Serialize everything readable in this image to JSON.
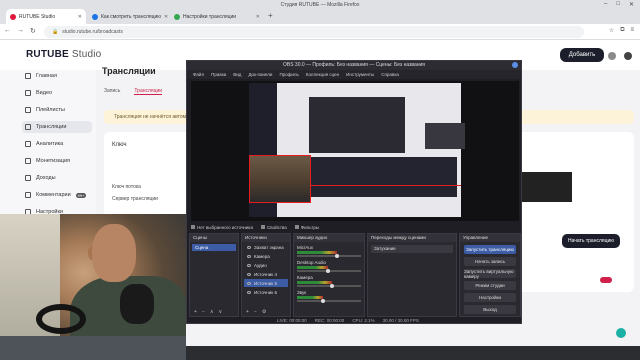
{
  "browser": {
    "window_title": "Студия RUTUBE — Mozilla Firefox",
    "tabs": [
      {
        "label": "RUTUBE Studio",
        "active": true,
        "color": "#e0193c"
      },
      {
        "label": "Как смотреть трансляцию",
        "active": false,
        "color": "#1a73e8"
      },
      {
        "label": "Настройки трансляции",
        "active": false,
        "color": "#34a853"
      }
    ],
    "address": "studio.rutube.ru/broadcasts",
    "nav": {
      "back": "←",
      "forward": "→",
      "reload": "↻"
    },
    "window_controls": {
      "minimize": "–",
      "maximize": "□",
      "close": "✕"
    }
  },
  "studio": {
    "logo_main": "RUTUBE",
    "logo_sub": "Studio",
    "add_button": "Добавить",
    "page_title": "Трансляции",
    "tabs": [
      "Запись",
      "Трансляции"
    ],
    "active_tab": 1,
    "warning": "Трансляция не начнётся автоматически — запустите её вручную",
    "card_label": "Ключ",
    "card_rows": [
      "Ключ потока",
      "Сервер трансляции"
    ],
    "start_button": "Начать трансляцию",
    "accent": "#d0204b"
  },
  "sidebar": {
    "items": [
      {
        "label": "Главная",
        "active": false
      },
      {
        "label": "Видео",
        "active": false
      },
      {
        "label": "Плейлисты",
        "active": false
      },
      {
        "label": "Трансляции",
        "active": true
      },
      {
        "label": "Аналитика",
        "active": false
      },
      {
        "label": "Монетизация",
        "active": false
      },
      {
        "label": "Доходы",
        "active": false
      },
      {
        "label": "Комментарии",
        "active": false,
        "badge": "99+"
      },
      {
        "label": "Настройки",
        "active": false
      }
    ]
  },
  "obs": {
    "title": "OBS 30.0 — Профиль: Без названия — Сцены: Без названия",
    "menu": [
      "Файл",
      "Правка",
      "Вид",
      "Док-панели",
      "Профиль",
      "Коллекция сцен",
      "Инструменты",
      "Справка"
    ],
    "status_tabs": [
      "Нет выбранного источника",
      "Свойства",
      "Фильтры"
    ],
    "docks": {
      "scenes": {
        "title": "Сцены",
        "items": [
          "Сцена"
        ]
      },
      "sources": {
        "title": "Источники",
        "items": [
          "Захват экрана",
          "Камера",
          "Аудио",
          "Источник 4",
          "Источник 5",
          "Источник 6"
        ],
        "selected": 4
      },
      "mixer": {
        "title": "Микшер аудио",
        "channels": [
          {
            "name": "Mic/Aux",
            "level": 0.62
          },
          {
            "name": "Desktop Audio",
            "level": 0.48
          },
          {
            "name": "Камера",
            "level": 0.55
          },
          {
            "name": "Звук",
            "level": 0.4
          }
        ]
      },
      "transitions_title": "Переходы между сценами",
      "transition": "Затухание",
      "controls": {
        "title": "Управление",
        "buttons": [
          "Запустить трансляцию",
          "Начать запись",
          "Запустить виртуальную камеру",
          "Режим студии",
          "Настройки",
          "Выход"
        ]
      }
    },
    "bottom": [
      "LIVE: 00:00:00",
      "REC: 00:00:00",
      "CPU: 2.1%",
      "30.00 / 30.00 FPS"
    ]
  }
}
